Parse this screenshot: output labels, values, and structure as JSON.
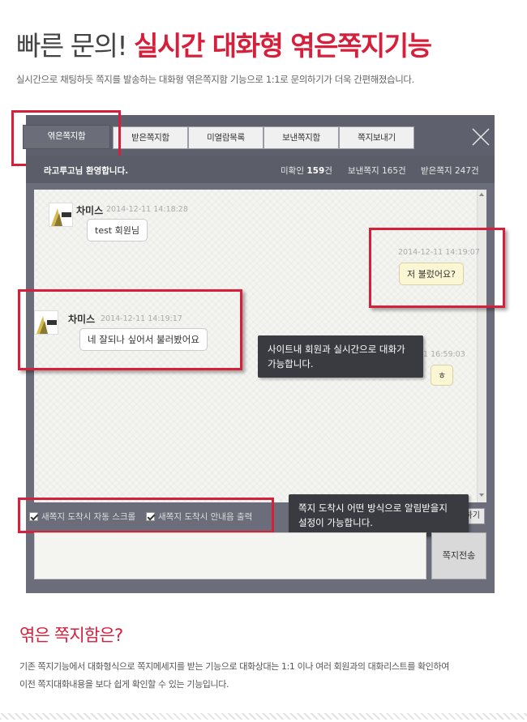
{
  "header": {
    "title_light": "빠른 문의!",
    "title_red": "실시간 대화형 엮은쪽지기능",
    "subtitle": "실시간으로 채팅하듯 쪽지를 발송하는 대화형 엮은쪽지함 기능으로 1:1로 문의하기가 더욱 간편해졌습니다."
  },
  "window": {
    "tabs": [
      {
        "label": "엮은쪽지함",
        "active": true
      },
      {
        "label": "받은쪽지함",
        "active": false
      },
      {
        "label": "미열람목록",
        "active": false
      },
      {
        "label": "보낸쪽지함",
        "active": false
      },
      {
        "label": "쪽지보내기",
        "active": false
      }
    ],
    "status": {
      "left": "라고루고님 환영합니다.",
      "unread_label": "미확인",
      "unread_count": "159",
      "unread_unit": "건",
      "sent": "보낸쪽지 165건",
      "received": "받은쪽지 247건"
    },
    "messages": [
      {
        "sender": "차미스",
        "time": "2014-12-11 14:18:28",
        "text": "test 회원님"
      },
      {
        "time": "2014-12-11 14:19:07",
        "text": "저 불렀어요?"
      },
      {
        "sender": "차미스",
        "time": "2014-12-11 14:19:17",
        "text": "네 잘되나 싶어서 불러봤어요"
      },
      {
        "time": "11 16:59:03",
        "text": "ㅎ"
      }
    ],
    "avatar_text": "CHAMIS",
    "options": {
      "autoscroll": "새쪽지 도착시 자동 스크롤",
      "notice": "새쪽지 도착시 안내음 출력"
    },
    "small_button": "하기",
    "send_button": "쪽지전송"
  },
  "callouts": {
    "realtime": [
      "사이트내 회원과 실시간으로 대화가",
      "가능합니다."
    ],
    "notify": [
      "쪽지 도착시 어떤 방식으로 알림받을지",
      "설정이 가능합니다."
    ]
  },
  "section": {
    "title": "엮은 쪽지함은?",
    "desc_line1": "기존 쪽지기능에서 대화형식으로 쪽지메세지를 받는 기능으로 대화상대는 1:1 이나 여러 회원과의 대화리스트를 확인하여",
    "desc_line2": "이전 쪽지대화내용을 보다 쉽게 확인할 수 있는 기능입니다."
  },
  "colors": {
    "accent": "#d51f3b",
    "window_bg": "#6b6d7a",
    "mine_bubble": "#fbf6d4"
  }
}
